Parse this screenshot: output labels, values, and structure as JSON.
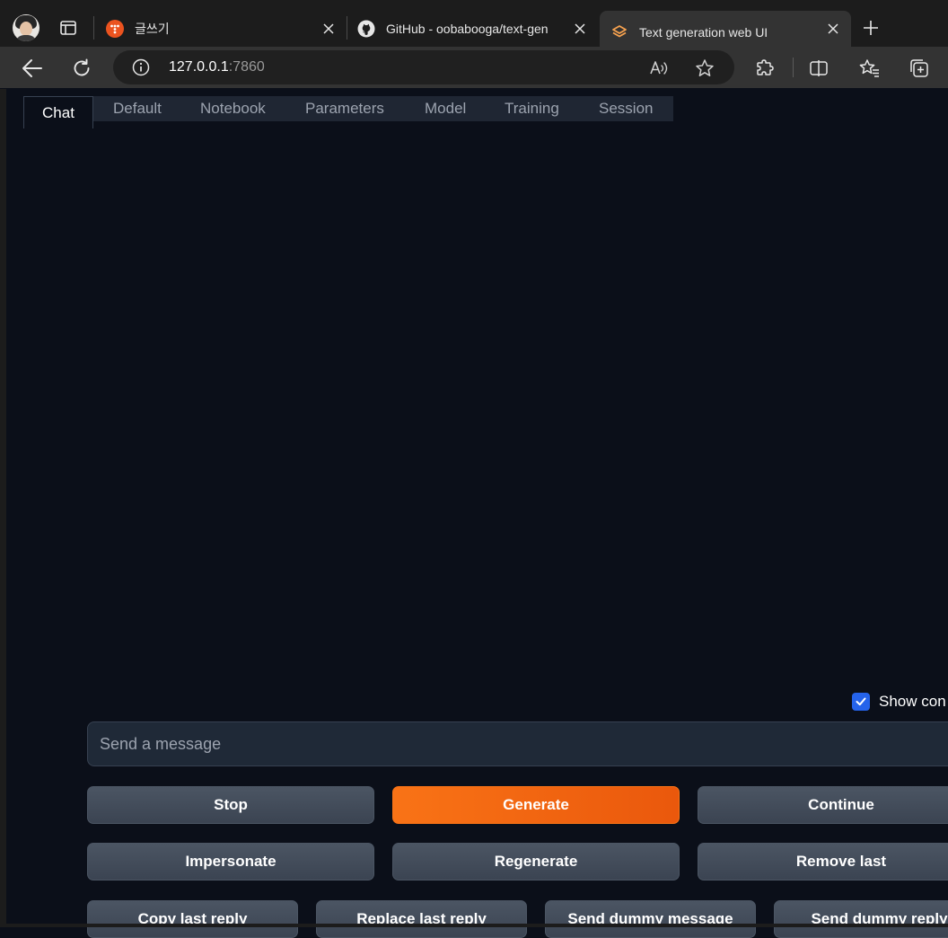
{
  "browser": {
    "tabs": [
      {
        "title": "글쓰기",
        "icon": "tistory-icon",
        "active": false
      },
      {
        "title": "GitHub - oobabooga/text-gen",
        "icon": "github-icon",
        "active": false
      },
      {
        "title": "Text generation web UI",
        "icon": "gradio-icon",
        "active": true
      }
    ],
    "address": {
      "host": "127.0.0.1",
      "port": ":7860"
    }
  },
  "app": {
    "tabs": [
      {
        "label": "Chat",
        "active": true
      },
      {
        "label": "Default"
      },
      {
        "label": "Notebook"
      },
      {
        "label": "Parameters"
      },
      {
        "label": "Model"
      },
      {
        "label": "Training"
      },
      {
        "label": "Session"
      }
    ],
    "show_controls": {
      "label": "Show con",
      "checked": true
    },
    "message_input": {
      "placeholder": "Send a message"
    },
    "buttons": {
      "row1": [
        "Stop",
        "Generate",
        "Continue"
      ],
      "row2": [
        "Impersonate",
        "Regenerate",
        "Remove last"
      ],
      "row3": [
        "Copy last reply",
        "Replace last reply",
        "Send dummy message",
        "Send dummy reply"
      ]
    }
  },
  "colors": {
    "page_bg": "#0b0f19",
    "primary_accent": "#f97316",
    "checkbox_accent": "#2563eb",
    "button_bg": "#4b5563"
  }
}
